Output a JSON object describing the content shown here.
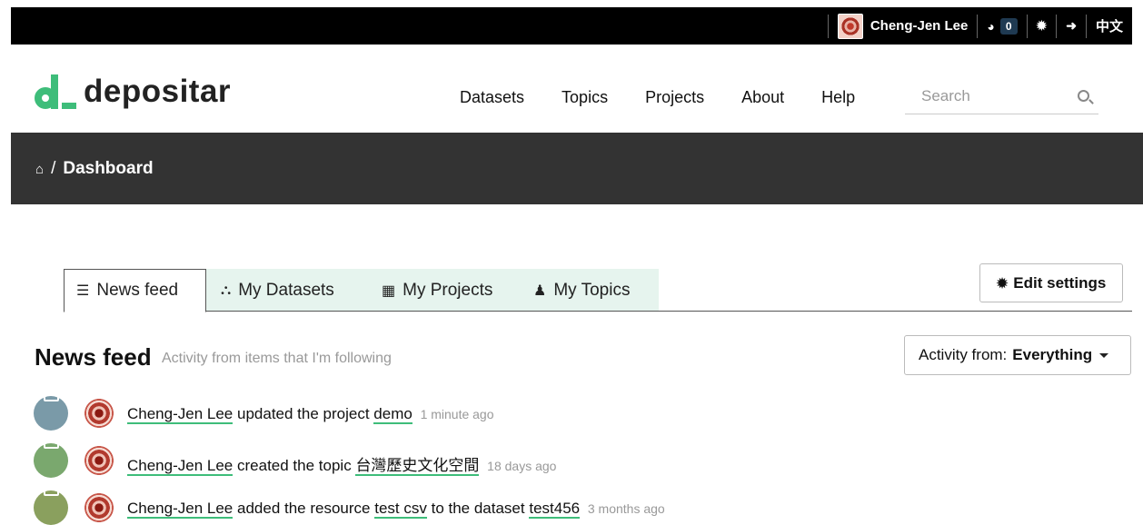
{
  "topbar": {
    "user_name": "Cheng-Jen Lee",
    "dashboard_count": "0",
    "language_label": "中文"
  },
  "brand": {
    "name": "depositar"
  },
  "nav": {
    "items": [
      "Datasets",
      "Topics",
      "Projects",
      "About",
      "Help"
    ],
    "search_placeholder": "Search"
  },
  "breadcrumb": {
    "current": "Dashboard"
  },
  "tabs": [
    {
      "label": "News feed",
      "icon": "list-icon",
      "active": true
    },
    {
      "label": "My Datasets",
      "icon": "sitemap-icon",
      "active": false
    },
    {
      "label": "My Projects",
      "icon": "building-icon",
      "active": false
    },
    {
      "label": "My Topics",
      "icon": "group-icon",
      "active": false
    }
  ],
  "edit_settings_label": "Edit settings",
  "feed": {
    "title": "News feed",
    "subtitle": "Activity from items that I'm following",
    "filter_prefix": "Activity from:",
    "filter_value": "Everything"
  },
  "activities": [
    {
      "actor": "Cheng-Jen Lee",
      "pre": "updated the project",
      "target": "demo",
      "mid": "",
      "target2": "",
      "time": "1 minute ago",
      "color": "#7a9aa8"
    },
    {
      "actor": "Cheng-Jen Lee",
      "pre": "created the topic",
      "target": "台灣歷史文化空間",
      "mid": "",
      "target2": "",
      "time": "18 days ago",
      "color": "#7aa86e"
    },
    {
      "actor": "Cheng-Jen Lee",
      "pre": "added the resource",
      "target": "test csv",
      "mid": "to the dataset",
      "target2": "test456",
      "time": "3 months ago",
      "color": "#8aa05e"
    }
  ],
  "colors": {
    "accent": "#3ebd7a",
    "topbar": "#000000",
    "crumbbar": "#333333",
    "tab_bg": "#e6f4ee"
  }
}
